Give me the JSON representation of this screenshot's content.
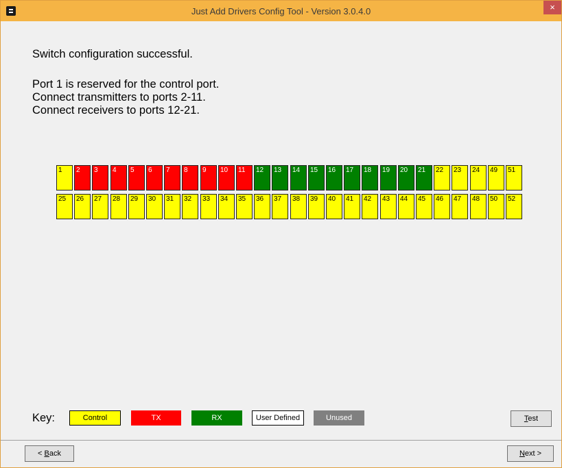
{
  "window": {
    "title": "Just Add Drivers Config Tool - Version 3.0.4.0",
    "close_glyph": "×"
  },
  "messages": {
    "success": "Switch configuration successful.",
    "line1": "Port 1 is reserved for the control port.",
    "line2": "Connect transmitters to ports 2-11.",
    "line3": "Connect receivers to ports 12-21."
  },
  "ports": {
    "top_row": [
      {
        "label": "1",
        "type": "control"
      },
      {
        "label": "2",
        "type": "tx"
      },
      {
        "label": "3",
        "type": "tx"
      },
      {
        "label": "4",
        "type": "tx"
      },
      {
        "label": "5",
        "type": "tx"
      },
      {
        "label": "6",
        "type": "tx"
      },
      {
        "label": "7",
        "type": "tx"
      },
      {
        "label": "8",
        "type": "tx"
      },
      {
        "label": "9",
        "type": "tx"
      },
      {
        "label": "10",
        "type": "tx"
      },
      {
        "label": "11",
        "type": "tx"
      },
      {
        "label": "12",
        "type": "rx"
      },
      {
        "label": "13",
        "type": "rx"
      },
      {
        "label": "14",
        "type": "rx"
      },
      {
        "label": "15",
        "type": "rx"
      },
      {
        "label": "16",
        "type": "rx"
      },
      {
        "label": "17",
        "type": "rx"
      },
      {
        "label": "18",
        "type": "rx"
      },
      {
        "label": "19",
        "type": "rx"
      },
      {
        "label": "20",
        "type": "rx"
      },
      {
        "label": "21",
        "type": "rx"
      },
      {
        "label": "22",
        "type": "control"
      },
      {
        "label": "23",
        "type": "control"
      },
      {
        "label": "24",
        "type": "control"
      },
      {
        "label": "49",
        "type": "control"
      },
      {
        "label": "51",
        "type": "control"
      }
    ],
    "bottom_row": [
      {
        "label": "25",
        "type": "control"
      },
      {
        "label": "26",
        "type": "control"
      },
      {
        "label": "27",
        "type": "control"
      },
      {
        "label": "28",
        "type": "control"
      },
      {
        "label": "29",
        "type": "control"
      },
      {
        "label": "30",
        "type": "control"
      },
      {
        "label": "31",
        "type": "control"
      },
      {
        "label": "32",
        "type": "control"
      },
      {
        "label": "33",
        "type": "control"
      },
      {
        "label": "34",
        "type": "control"
      },
      {
        "label": "35",
        "type": "control"
      },
      {
        "label": "36",
        "type": "control"
      },
      {
        "label": "37",
        "type": "control"
      },
      {
        "label": "38",
        "type": "control"
      },
      {
        "label": "39",
        "type": "control"
      },
      {
        "label": "40",
        "type": "control"
      },
      {
        "label": "41",
        "type": "control"
      },
      {
        "label": "42",
        "type": "control"
      },
      {
        "label": "43",
        "type": "control"
      },
      {
        "label": "44",
        "type": "control"
      },
      {
        "label": "45",
        "type": "control"
      },
      {
        "label": "46",
        "type": "control"
      },
      {
        "label": "47",
        "type": "control"
      },
      {
        "label": "48",
        "type": "control"
      },
      {
        "label": "50",
        "type": "control"
      },
      {
        "label": "52",
        "type": "control"
      }
    ]
  },
  "key": {
    "label": "Key:",
    "control": "Control",
    "tx": "TX",
    "rx": "RX",
    "user_defined": "User Defined",
    "unused": "Unused"
  },
  "buttons": {
    "test": {
      "mnemonic": "T",
      "rest": "est"
    },
    "back": {
      "prefix": "< ",
      "mnemonic": "B",
      "rest": "ack"
    },
    "next": {
      "mnemonic": "N",
      "rest": "ext >"
    }
  },
  "colors": {
    "title_bar": "#f5b445",
    "control": "#ffff00",
    "tx": "#ff0000",
    "rx": "#008000",
    "unused": "#808080"
  }
}
